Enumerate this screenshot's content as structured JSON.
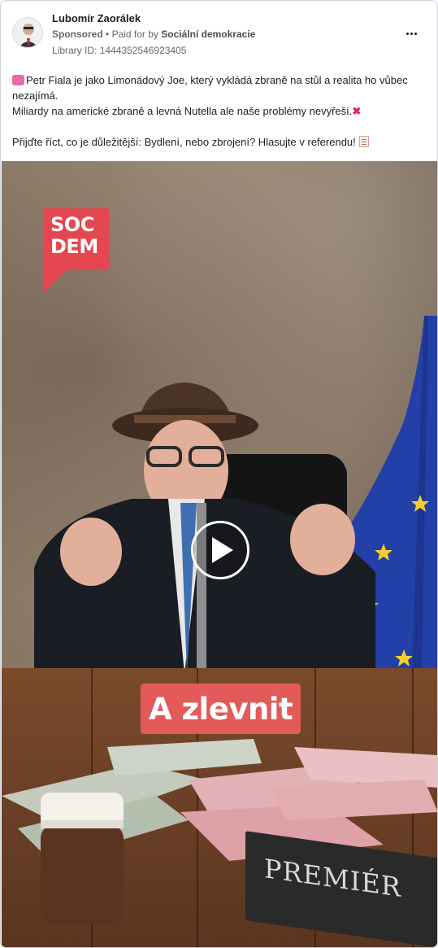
{
  "post": {
    "author": "Lubomír Zaorálek",
    "sponsored_label": "Sponsored",
    "paid_for_prefix": "Paid for by",
    "paid_for_org": "Sociální demokracie",
    "library_id": "Library ID: 1444352546923405"
  },
  "text": {
    "line1": "Petr Fiala je jako Limonádový Joe, který vykládá zbraně na stůl a realita ho vůbec nezajímá.",
    "line2": "Miliardy na americké zbraně a levná Nutella ale naše problémy nevyřeší.",
    "line3": "Přijďte říct, co je důležitější: Bydlení, nebo zbrojení? Hlasujte v referendu!"
  },
  "media": {
    "logo_line1": "SOC",
    "logo_line2": "DEM",
    "caption": "A zlevnit",
    "nameplate": "PREMIÉR"
  },
  "icons": {
    "more": "more-horizontal-icon",
    "play": "play-icon"
  }
}
